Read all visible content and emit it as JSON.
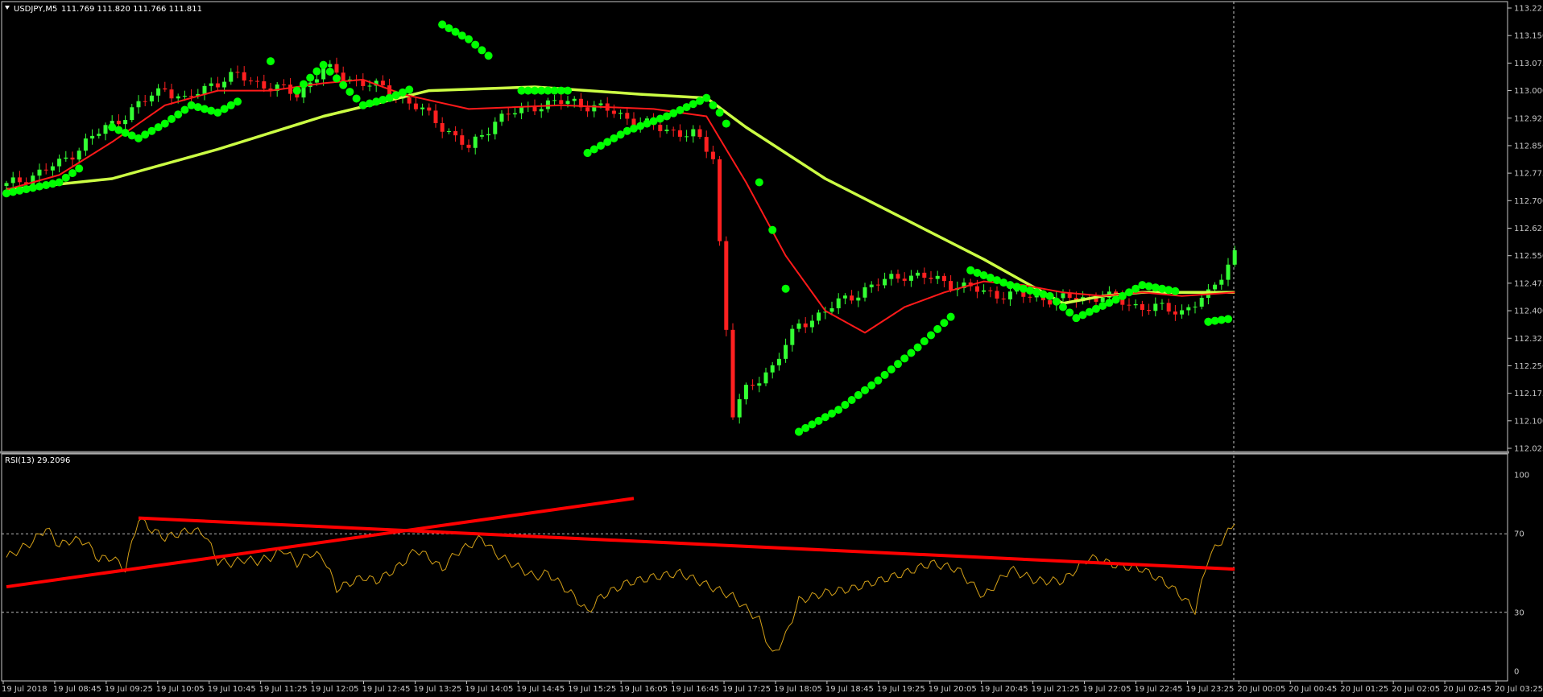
{
  "main_panel": {
    "header_symbol": "USDJPY,M5",
    "header_prices": "111.769 111.820 111.766 111.811",
    "price_ticks": [
      "113.225",
      "113.150",
      "113.075",
      "113.000",
      "112.925",
      "112.850",
      "112.775",
      "112.700",
      "112.625",
      "112.550",
      "112.475",
      "112.400",
      "112.325",
      "112.250",
      "112.175",
      "112.100",
      "112.025"
    ]
  },
  "rsi_panel": {
    "header": "RSI(13) 29.2096",
    "level_ticks": [
      "100",
      "70",
      "30",
      "0"
    ]
  },
  "time_ticks": [
    "19 Jul 2018",
    "19 Jul 08:45",
    "19 Jul 09:25",
    "19 Jul 10:05",
    "19 Jul 10:45",
    "19 Jul 11:25",
    "19 Jul 12:05",
    "19 Jul 12:45",
    "19 Jul 13:25",
    "19 Jul 14:05",
    "19 Jul 14:45",
    "19 Jul 15:25",
    "19 Jul 16:05",
    "19 Jul 16:45",
    "19 Jul 17:25",
    "19 Jul 18:05",
    "19 Jul 18:45",
    "19 Jul 19:25",
    "19 Jul 20:05",
    "19 Jul 20:45",
    "19 Jul 21:25",
    "19 Jul 22:05",
    "19 Jul 22:45",
    "19 Jul 23:25",
    "20 Jul 00:05",
    "20 Jul 00:45",
    "20 Jul 01:25",
    "20 Jul 02:05",
    "20 Jul 02:45",
    "20 Jul 03:25"
  ],
  "colors": {
    "background": "#000000",
    "axis": "#c8c8c8",
    "bull": "#33ff33",
    "bear": "#ff2020",
    "ma_fast": "#ff1a1a",
    "ma_slow": "#ccff44",
    "sar": "#00ff00",
    "rsi": "#d4a017",
    "trendline": "#ff0000"
  },
  "chart_data": [
    {
      "type": "line",
      "kind": "candlestick",
      "symbol": "USDJPY",
      "timeframe": "M5",
      "ylim": [
        112.025,
        113.225
      ],
      "x_ticks": [
        "19 Jul 2018",
        "19 Jul 08:45",
        "19 Jul 09:25",
        "19 Jul 10:05",
        "19 Jul 10:45",
        "19 Jul 11:25",
        "19 Jul 12:05",
        "19 Jul 12:45",
        "19 Jul 13:25",
        "19 Jul 14:05",
        "19 Jul 14:45",
        "19 Jul 15:25",
        "19 Jul 16:05",
        "19 Jul 16:45",
        "19 Jul 17:25",
        "19 Jul 18:05",
        "19 Jul 18:45",
        "19 Jul 19:25",
        "19 Jul 20:05",
        "19 Jul 20:45",
        "19 Jul 21:25",
        "19 Jul 22:05",
        "19 Jul 22:45",
        "19 Jul 23:25",
        "20 Jul 00:05",
        "20 Jul 00:45",
        "20 Jul 01:25",
        "20 Jul 02:05",
        "20 Jul 02:45",
        "20 Jul 03:25"
      ],
      "price_path": [
        [
          0,
          112.74
        ],
        [
          8,
          112.8
        ],
        [
          12,
          112.86
        ],
        [
          16,
          112.91
        ],
        [
          20,
          112.96
        ],
        [
          24,
          113.01
        ],
        [
          27,
          112.97
        ],
        [
          31,
          113.02
        ],
        [
          35,
          113.04
        ],
        [
          40,
          113.01
        ],
        [
          44,
          112.99
        ],
        [
          48,
          113.06
        ],
        [
          54,
          113.02
        ],
        [
          58,
          113.0
        ],
        [
          65,
          112.92
        ],
        [
          70,
          112.84
        ],
        [
          74,
          112.92
        ],
        [
          80,
          112.96
        ],
        [
          86,
          112.97
        ],
        [
          92,
          112.94
        ],
        [
          98,
          112.9
        ],
        [
          104,
          112.88
        ],
        [
          107,
          112.82
        ],
        [
          110,
          112.12
        ],
        [
          112,
          112.18
        ],
        [
          116,
          112.25
        ],
        [
          120,
          112.36
        ],
        [
          124,
          112.4
        ],
        [
          130,
          112.46
        ],
        [
          136,
          112.5
        ],
        [
          142,
          112.48
        ],
        [
          148,
          112.45
        ],
        [
          154,
          112.44
        ],
        [
          160,
          112.43
        ],
        [
          166,
          112.44
        ],
        [
          172,
          112.41
        ],
        [
          178,
          112.4
        ],
        [
          182,
          112.44
        ],
        [
          186,
          112.56
        ]
      ],
      "series": [
        {
          "name": "",
          "role": "ma_fast",
          "values": [
            [
              0,
              112.73
            ],
            [
              8,
              112.77
            ],
            [
              16,
              112.86
            ],
            [
              24,
              112.96
            ],
            [
              32,
              113.0
            ],
            [
              40,
              113.0
            ],
            [
              48,
              113.02
            ],
            [
              54,
              113.03
            ],
            [
              60,
              112.99
            ],
            [
              70,
              112.95
            ],
            [
              84,
              112.96
            ],
            [
              98,
              112.95
            ],
            [
              106,
              112.93
            ],
            [
              112,
              112.75
            ],
            [
              118,
              112.55
            ],
            [
              124,
              112.4
            ],
            [
              130,
              112.34
            ],
            [
              136,
              112.41
            ],
            [
              142,
              112.45
            ],
            [
              148,
              112.48
            ],
            [
              154,
              112.47
            ],
            [
              160,
              112.45
            ],
            [
              166,
              112.44
            ],
            [
              172,
              112.45
            ],
            [
              178,
              112.44
            ],
            [
              186,
              112.45
            ]
          ]
        },
        {
          "name": "",
          "role": "ma_slow",
          "values": [
            [
              0,
              112.73
            ],
            [
              16,
              112.76
            ],
            [
              32,
              112.84
            ],
            [
              48,
              112.93
            ],
            [
              64,
              113.0
            ],
            [
              80,
              113.01
            ],
            [
              96,
              112.99
            ],
            [
              106,
              112.98
            ],
            [
              112,
              112.9
            ],
            [
              124,
              112.76
            ],
            [
              136,
              112.65
            ],
            [
              148,
              112.54
            ],
            [
              154,
              112.48
            ],
            [
              160,
              112.42
            ],
            [
              166,
              112.44
            ],
            [
              172,
              112.45
            ],
            [
              186,
              112.45
            ]
          ]
        },
        {
          "name": "",
          "role": "parabolic_sar",
          "values": [
            [
              0,
              112.72
            ],
            [
              8,
              112.75
            ],
            [
              12,
              112.8
            ],
            [
              16,
              112.9
            ],
            [
              20,
              112.87
            ],
            [
              24,
              112.91
            ],
            [
              28,
              112.96
            ],
            [
              32,
              112.94
            ],
            [
              36,
              112.98
            ],
            [
              40,
              113.08
            ],
            [
              44,
              113.0
            ],
            [
              48,
              113.07
            ],
            [
              54,
              112.96
            ],
            [
              58,
              112.98
            ],
            [
              62,
              113.01
            ],
            [
              66,
              113.18
            ],
            [
              70,
              113.14
            ],
            [
              74,
              113.08
            ],
            [
              78,
              113.0
            ],
            [
              86,
              113.0
            ],
            [
              88,
              112.83
            ],
            [
              94,
              112.89
            ],
            [
              100,
              112.93
            ],
            [
              106,
              112.98
            ],
            [
              108,
              112.94
            ],
            [
              110,
              112.88
            ],
            [
              114,
              112.75
            ],
            [
              116,
              112.62
            ],
            [
              118,
              112.46
            ],
            [
              120,
              112.07
            ],
            [
              126,
              112.13
            ],
            [
              132,
              112.21
            ],
            [
              138,
              112.3
            ],
            [
              144,
              112.4
            ],
            [
              146,
              112.51
            ],
            [
              152,
              112.47
            ],
            [
              158,
              112.44
            ],
            [
              162,
              112.38
            ],
            [
              168,
              112.43
            ],
            [
              172,
              112.47
            ],
            [
              178,
              112.45
            ],
            [
              182,
              112.37
            ],
            [
              186,
              112.38
            ]
          ]
        }
      ]
    },
    {
      "type": "line",
      "title": "RSI(13) 29.2096",
      "ylim": [
        0,
        100
      ],
      "levels": [
        30,
        70
      ],
      "series": [
        {
          "name": "",
          "values": [
            [
              0,
              58
            ],
            [
              4,
              66
            ],
            [
              6,
              73
            ],
            [
              8,
              64
            ],
            [
              10,
              67
            ],
            [
              12,
              66
            ],
            [
              14,
              57
            ],
            [
              16,
              58
            ],
            [
              18,
              52
            ],
            [
              20,
              78
            ],
            [
              22,
              72
            ],
            [
              24,
              68
            ],
            [
              26,
              70
            ],
            [
              28,
              72
            ],
            [
              30,
              70
            ],
            [
              32,
              56
            ],
            [
              34,
              55
            ],
            [
              36,
              57
            ],
            [
              38,
              56
            ],
            [
              40,
              58
            ],
            [
              42,
              62
            ],
            [
              44,
              55
            ],
            [
              46,
              60
            ],
            [
              48,
              58
            ],
            [
              50,
              42
            ],
            [
              52,
              45
            ],
            [
              54,
              48
            ],
            [
              56,
              46
            ],
            [
              58,
              50
            ],
            [
              60,
              55
            ],
            [
              62,
              62
            ],
            [
              64,
              58
            ],
            [
              66,
              52
            ],
            [
              68,
              60
            ],
            [
              70,
              64
            ],
            [
              72,
              68
            ],
            [
              74,
              60
            ],
            [
              76,
              56
            ],
            [
              78,
              52
            ],
            [
              80,
              48
            ],
            [
              82,
              50
            ],
            [
              84,
              44
            ],
            [
              86,
              38
            ],
            [
              88,
              30
            ],
            [
              90,
              38
            ],
            [
              94,
              45
            ],
            [
              98,
              48
            ],
            [
              102,
              50
            ],
            [
              106,
              44
            ],
            [
              110,
              38
            ],
            [
              112,
              32
            ],
            [
              114,
              26
            ],
            [
              116,
              8
            ],
            [
              118,
              18
            ],
            [
              120,
              36
            ],
            [
              124,
              40
            ],
            [
              128,
              42
            ],
            [
              132,
              46
            ],
            [
              136,
              50
            ],
            [
              140,
              55
            ],
            [
              144,
              52
            ],
            [
              148,
              38
            ],
            [
              152,
              52
            ],
            [
              156,
              46
            ],
            [
              160,
              46
            ],
            [
              164,
              58
            ],
            [
              168,
              54
            ],
            [
              172,
              52
            ],
            [
              176,
              44
            ],
            [
              178,
              38
            ],
            [
              180,
              31
            ],
            [
              182,
              58
            ],
            [
              186,
              75
            ]
          ]
        }
      ],
      "trendlines": [
        {
          "from": [
            0,
            43
          ],
          "to": [
            95,
            88
          ]
        },
        {
          "from": [
            20,
            78
          ],
          "to": [
            186,
            52
          ]
        }
      ]
    }
  ]
}
